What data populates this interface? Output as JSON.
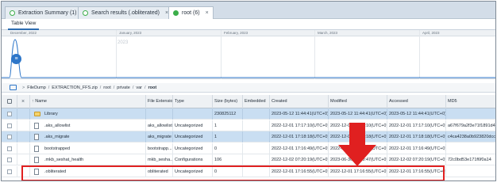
{
  "tabs": [
    {
      "label": "Extraction Summary (1)",
      "close": "×",
      "active": false,
      "dot": "ring"
    },
    {
      "label": "Search results (.obliterated)",
      "close": "×",
      "active": false,
      "dot": "ring"
    },
    {
      "label": "root (6)",
      "close": "×",
      "active": true,
      "dot": "fill"
    }
  ],
  "view_tab": "Table View",
  "timeline": {
    "months": [
      "December, 2022",
      "January, 2023",
      "February, 2023",
      "March, 2023",
      "April, 2023"
    ],
    "year_label": "2023",
    "dot_icon": "list-icon",
    "dot_glyph": "≡"
  },
  "path": {
    "icon": "folder-path-icon",
    "segments": [
      "FileDump",
      "EXTRACTION_FFS.zip",
      "root",
      "private",
      "var",
      "root"
    ],
    "separator": "/"
  },
  "table": {
    "columns": [
      "",
      "",
      "Name",
      "File Extension",
      "Type",
      "Size (bytes)",
      "Embedded",
      "Created",
      "Modified",
      "Accessed",
      "MD5"
    ],
    "rows": [
      {
        "name": "Library",
        "ext": "",
        "type": "",
        "size": "230825112",
        "embedded": "",
        "created": "2023-05-12 11:44:41(UTC+0)",
        "modified": "2023-05-12 11:44:41(UTC+0)",
        "accessed": "2023-05-12 11:44:41(UTC+0)",
        "md5": "",
        "icon": "folder",
        "selected": true
      },
      {
        "name": ".aks_allowlist",
        "ext": "aks_allowlist",
        "type": "Uncategorized",
        "size": "1",
        "embedded": "",
        "created": "2022-12-01 17:17:10(UTC+0)",
        "modified": "2022-12-01 17:17:10(UTC+0)",
        "accessed": "2022-12-01 17:17:10(UTC+0)",
        "md5": "a67f679a2f3e71f1891d4",
        "icon": "file",
        "selected": false
      },
      {
        "name": ".aks_migrate",
        "ext": "aks_migrate",
        "type": "Uncategorized",
        "size": "1",
        "embedded": "",
        "created": "2022-12-01 17:18:18(UTC+0)",
        "modified": "2022-12-01 17:18:18(UTC+0)",
        "accessed": "2022-12-01 17:18:18(UTC+0)",
        "md5": "c4ca4238a0b923820dcc",
        "icon": "file",
        "selected": true
      },
      {
        "name": "bootstrapped",
        "ext": "bootstrapp...",
        "type": "Uncategorized",
        "size": "0",
        "embedded": "",
        "created": "2022-12-01 17:16:49(UTC+0)",
        "modified": "2022-12-01 17:16:49(UTC+0)",
        "accessed": "2022-12-01 17:16:49(UTC+0)",
        "md5": "",
        "icon": "file",
        "selected": false
      },
      {
        "name": ".mkb_seshat_health",
        "ext": "mkb_sesha...",
        "type": "Configurations",
        "size": "106",
        "embedded": "",
        "created": "2022-12-02 07:20:19(UTC+0)",
        "modified": "2023-06-30 17:50:47(UTC+0)",
        "accessed": "2022-12-02 07:20:19(UTC+0)",
        "md5": "72c0bd53e171f6f0a14",
        "icon": "file",
        "selected": false
      },
      {
        "name": ".obliterated",
        "ext": "obliterated",
        "type": "Uncategorized",
        "size": "0",
        "embedded": "",
        "created": "2022-12-01 17:16:55(UTC+0)",
        "modified": "2022-12-01 17:16:55(UTC+0)",
        "accessed": "2022-12-01 17:16:55(UTC+0)",
        "md5": "",
        "icon": "file",
        "selected": false
      }
    ]
  },
  "colors": {
    "highlight": "#e02020",
    "selected_row": "#c9def2",
    "accent": "#2d76c9"
  }
}
